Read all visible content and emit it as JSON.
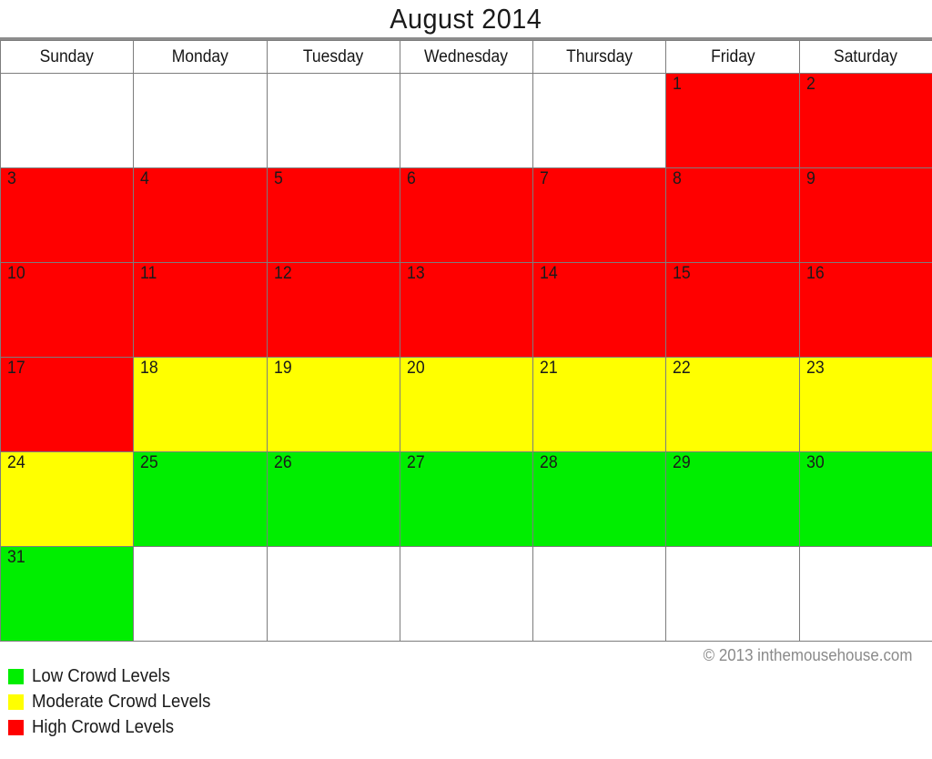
{
  "header": {
    "title": "August 2014"
  },
  "weekdays": [
    "Sunday",
    "Monday",
    "Tuesday",
    "Wednesday",
    "Thursday",
    "Friday",
    "Saturday"
  ],
  "colors": {
    "high": "#ff0000",
    "moderate": "#ffff00",
    "low": "#00ee00",
    "empty": "#ffffff",
    "grid_line": "#7d7d7d",
    "title_rule": "#8c8c8c",
    "text": "#1a1a1a",
    "copyright_text": "#8a8a8a"
  },
  "weeks": [
    [
      {
        "day": "",
        "level": "none"
      },
      {
        "day": "",
        "level": "none"
      },
      {
        "day": "",
        "level": "none"
      },
      {
        "day": "",
        "level": "none"
      },
      {
        "day": "",
        "level": "none"
      },
      {
        "day": "1",
        "level": "high"
      },
      {
        "day": "2",
        "level": "high"
      }
    ],
    [
      {
        "day": "3",
        "level": "high"
      },
      {
        "day": "4",
        "level": "high"
      },
      {
        "day": "5",
        "level": "high"
      },
      {
        "day": "6",
        "level": "high"
      },
      {
        "day": "7",
        "level": "high"
      },
      {
        "day": "8",
        "level": "high"
      },
      {
        "day": "9",
        "level": "high"
      }
    ],
    [
      {
        "day": "10",
        "level": "high"
      },
      {
        "day": "11",
        "level": "high"
      },
      {
        "day": "12",
        "level": "high"
      },
      {
        "day": "13",
        "level": "high"
      },
      {
        "day": "14",
        "level": "high"
      },
      {
        "day": "15",
        "level": "high"
      },
      {
        "day": "16",
        "level": "high"
      }
    ],
    [
      {
        "day": "17",
        "level": "high"
      },
      {
        "day": "18",
        "level": "moderate"
      },
      {
        "day": "19",
        "level": "moderate"
      },
      {
        "day": "20",
        "level": "moderate"
      },
      {
        "day": "21",
        "level": "moderate"
      },
      {
        "day": "22",
        "level": "moderate"
      },
      {
        "day": "23",
        "level": "moderate"
      }
    ],
    [
      {
        "day": "24",
        "level": "moderate"
      },
      {
        "day": "25",
        "level": "low"
      },
      {
        "day": "26",
        "level": "low"
      },
      {
        "day": "27",
        "level": "low"
      },
      {
        "day": "28",
        "level": "low"
      },
      {
        "day": "29",
        "level": "low"
      },
      {
        "day": "30",
        "level": "low"
      }
    ],
    [
      {
        "day": "31",
        "level": "low"
      },
      {
        "day": "",
        "level": "none"
      },
      {
        "day": "",
        "level": "none"
      },
      {
        "day": "",
        "level": "none"
      },
      {
        "day": "",
        "level": "none"
      },
      {
        "day": "",
        "level": "none"
      },
      {
        "day": "",
        "level": "none"
      }
    ]
  ],
  "legend": {
    "items": [
      {
        "key": "low",
        "label": "Low Crowd Levels"
      },
      {
        "key": "mod",
        "label": "Moderate Crowd Levels"
      },
      {
        "key": "high",
        "label": "High Crowd Levels"
      }
    ]
  },
  "footer": {
    "copyright": "© 2013 inthemousehouse.com"
  }
}
